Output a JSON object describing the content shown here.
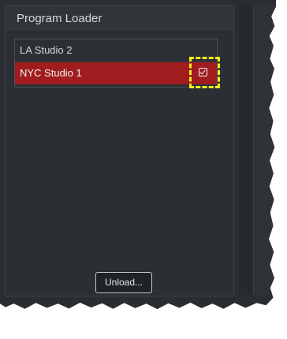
{
  "panel": {
    "title": "Program Loader"
  },
  "list": {
    "items": [
      {
        "label": "LA Studio 2",
        "selected": false
      },
      {
        "label": "NYC Studio 1",
        "selected": true,
        "icon": "checkbox-checked-icon"
      }
    ]
  },
  "buttons": {
    "unload_label": "Unload..."
  },
  "colors": {
    "selected_row": "#a01c1f",
    "highlight": "#f3f019",
    "panel_bg": "#2b2f33"
  }
}
